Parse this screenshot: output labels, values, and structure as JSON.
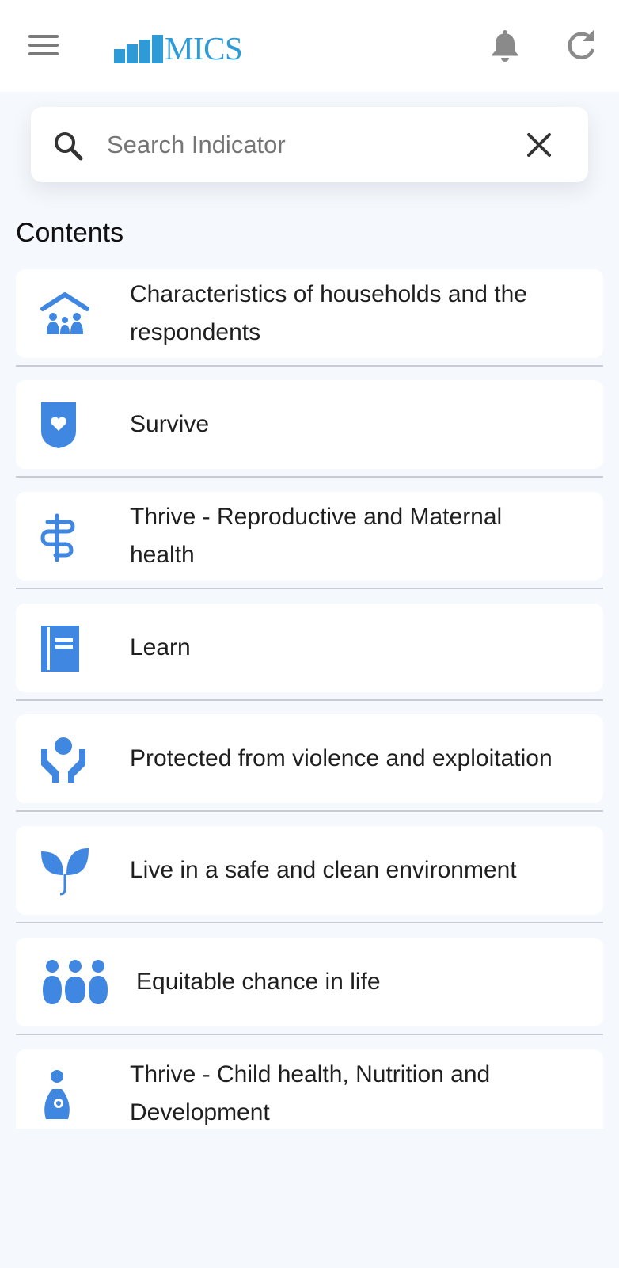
{
  "appbar": {
    "menu_icon": "hamburger-menu-icon",
    "logo_text": "MICS",
    "notification_icon": "bell-icon",
    "refresh_icon": "refresh-icon"
  },
  "search": {
    "icon": "search-icon",
    "placeholder": "Search Indicator",
    "value": "",
    "clear_icon": "close-icon"
  },
  "contents": {
    "title": "Contents",
    "items": [
      {
        "label": "Characteristics of households and the respondents",
        "icon": "household-family-icon"
      },
      {
        "label": "Survive",
        "icon": "shield-heart-icon"
      },
      {
        "label": "Thrive - Reproductive and Maternal health",
        "icon": "caduceus-icon"
      },
      {
        "label": "Learn",
        "icon": "notebook-icon"
      },
      {
        "label": "Protected from violence and exploitation",
        "icon": "protecting-hands-icon"
      },
      {
        "label": "Live in a safe and clean environment",
        "icon": "sprout-icon"
      },
      {
        "label": "Equitable chance in life",
        "icon": "people-group-icon"
      },
      {
        "label": "Thrive - Child health, Nutrition and Development",
        "icon": "mother-child-icon"
      }
    ]
  },
  "colors": {
    "accent": "#3f87e0",
    "logo": "#2e9bd6",
    "background": "#f5f8fc",
    "card": "#ffffff",
    "divider": "#c9ccd6"
  }
}
